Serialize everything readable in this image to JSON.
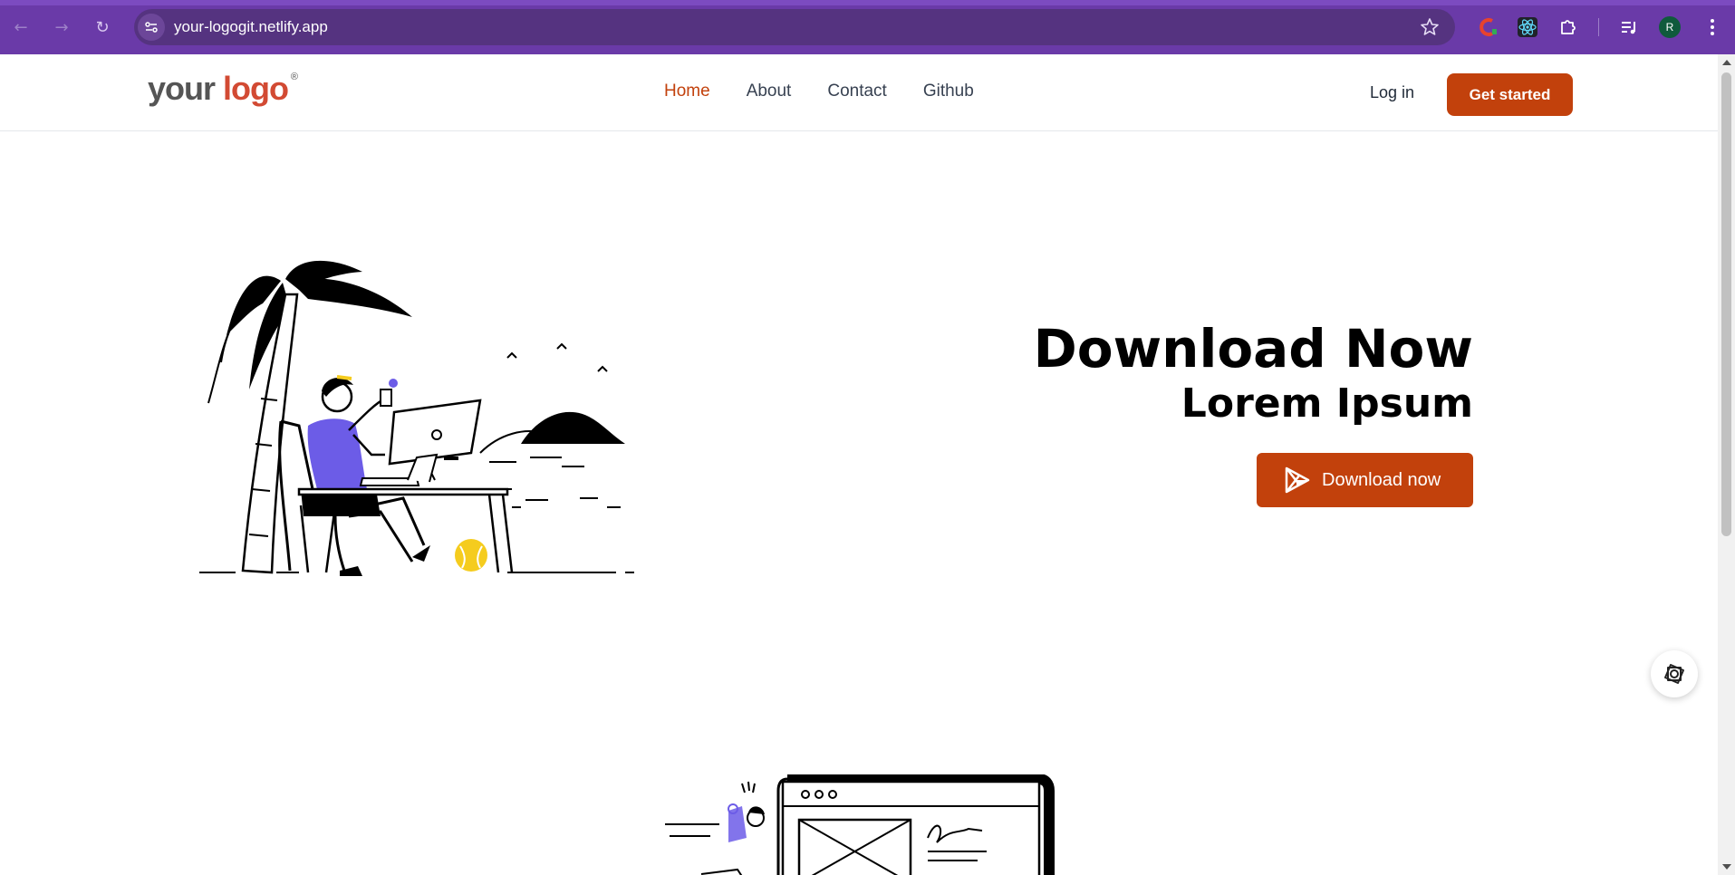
{
  "browser": {
    "url": "your-logogit.netlify.app",
    "profile_initial": "R",
    "icons": [
      "back-icon",
      "forward-icon",
      "reload-icon",
      "site-settings-icon",
      "bookmark-star-icon",
      "extension-c-icon",
      "react-devtools-icon",
      "extensions-puzzle-icon",
      "media-queue-icon",
      "kebab-menu-icon"
    ],
    "back": "←",
    "forward": "→",
    "reload": "↻"
  },
  "site": {
    "logo": {
      "your": "your",
      "logo": "logo",
      "reg": "®"
    },
    "nav": [
      {
        "label": "Home",
        "active": true
      },
      {
        "label": "About",
        "active": false
      },
      {
        "label": "Contact",
        "active": false
      },
      {
        "label": "Github",
        "active": false
      }
    ],
    "login_label": "Log in",
    "cta_label": "Get started"
  },
  "hero": {
    "title": "Download Now",
    "subtitle": "Lorem Ipsum",
    "button_label": "Download now"
  },
  "colors": {
    "accent": "#c2410c",
    "browser": "#6a3aa8",
    "logo_red": "#d24a33",
    "illustration_purple": "#6c5ce7",
    "illustration_yellow": "#f5cc1e"
  }
}
